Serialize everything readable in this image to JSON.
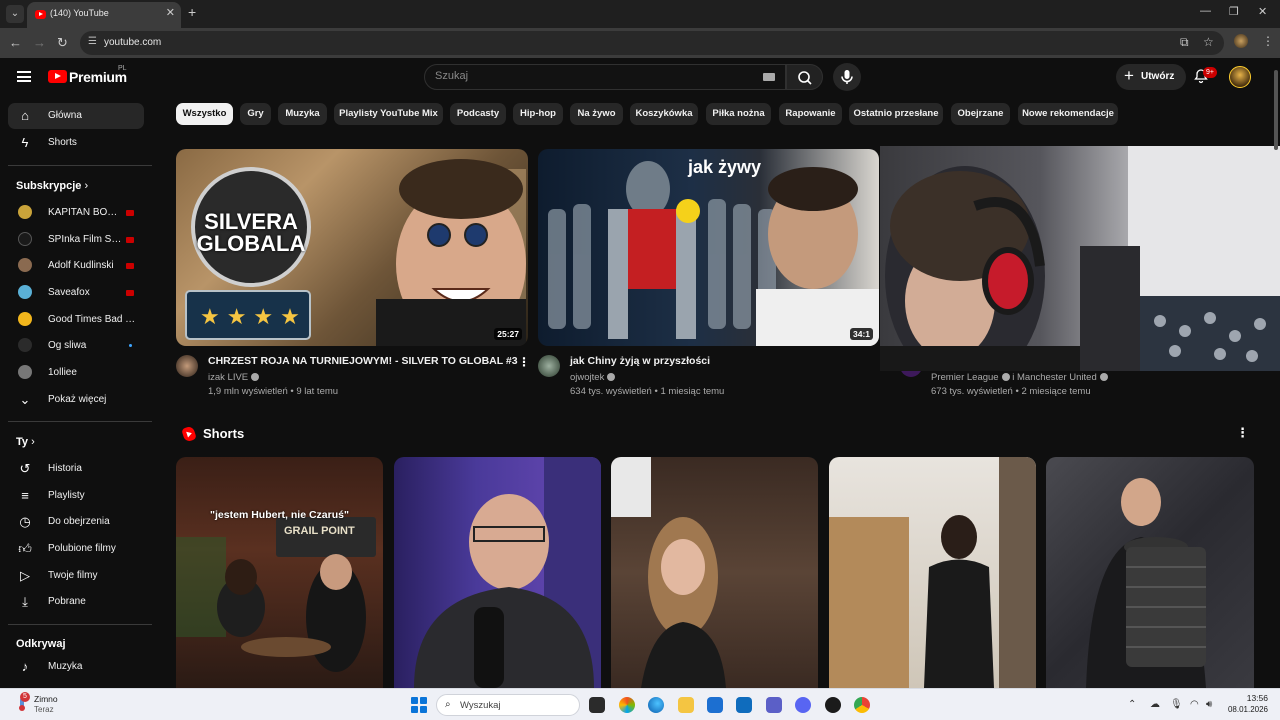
{
  "browser": {
    "tab_title": "(140) YouTube",
    "url": "youtube.com"
  },
  "masthead": {
    "logo_text": "Premium",
    "logo_region": "PL",
    "search_placeholder": "Szukaj",
    "create_label": "Utwórz",
    "notifications_badge": "9+"
  },
  "sidebar": {
    "main": [
      {
        "label": "Główna",
        "icon": "home-icon",
        "active": true
      },
      {
        "label": "Shorts",
        "icon": "shorts-icon",
        "active": false
      }
    ],
    "subscriptions_title": "Subskrypcje",
    "subscriptions": [
      {
        "label": "KAPITAN BOMB...",
        "indicator": "live",
        "color": "#c9a33a"
      },
      {
        "label": "SPInka Film Stud...",
        "indicator": "live",
        "color": "#1a1a1a"
      },
      {
        "label": "Adolf Kudlinski",
        "indicator": "live",
        "color": "#8a6a50"
      },
      {
        "label": "Saveafox",
        "indicator": "live",
        "color": "#5ab0d6"
      },
      {
        "label": "Good Times Bad Ti...",
        "indicator": "none",
        "color": "#f2b61c"
      },
      {
        "label": "Og sliwa",
        "indicator": "dot",
        "color": "#2b2b2b"
      },
      {
        "label": "1olliee",
        "indicator": "none",
        "color": "#777777"
      }
    ],
    "show_more": "Pokaż więcej",
    "you_title": "Ty",
    "you_items": [
      {
        "label": "Historia",
        "icon": "history-icon"
      },
      {
        "label": "Playlisty",
        "icon": "playlists-icon"
      },
      {
        "label": "Do obejrzenia",
        "icon": "watch-later-icon"
      },
      {
        "label": "Polubione filmy",
        "icon": "like-icon"
      },
      {
        "label": "Twoje filmy",
        "icon": "your-videos-icon"
      },
      {
        "label": "Pobrane",
        "icon": "download-icon"
      }
    ],
    "explore_title": "Odkrywaj",
    "explore_items": [
      {
        "label": "Muzyka",
        "icon": "music-icon"
      }
    ]
  },
  "chips": [
    "Wszystko",
    "Gry",
    "Muzyka",
    "Playlisty YouTube Mix",
    "Podcasty",
    "Hip-hop",
    "Na żywo",
    "Koszykówka",
    "Piłka nożna",
    "Rapowanie",
    "Ostatnio przesłane",
    "Obejrzane",
    "Nowe rekomendacje"
  ],
  "videos": [
    {
      "title": "CHRZEST ROJA NA TURNIEJOWYM! - SILVER TO GLOBAL #3",
      "channel": "izak LIVE",
      "meta": "1,9 mln wyświetleń • 9 lat temu",
      "duration": "25:27",
      "thumb_text": "SILVERA GLOBALA"
    },
    {
      "title": "jak Chiny żyją w przyszłości",
      "channel": "ojwojtek",
      "meta": "634 tys. wyświetleń • 1 miesiąc temu",
      "duration": "34:1",
      "thumb_text": "jak żywy"
    },
    {
      "title": "",
      "channel": "Premier League",
      "channel_extra": "i Manchester United",
      "meta": "673 tys. wyświetleń • 2 miesiące temu",
      "duration": ""
    }
  ],
  "shorts": {
    "title": "Shorts",
    "items": [
      {
        "caption": "\"jestem Hubert, nie Czaruś\"",
        "sign": "GRAIL POINT"
      },
      {
        "caption": ""
      },
      {
        "caption": ""
      },
      {
        "caption": ""
      },
      {
        "caption": ""
      }
    ]
  },
  "taskbar": {
    "weather_title": "Zimno",
    "weather_sub": "Teraz",
    "weather_badge": "5",
    "search_label": "Wyszukaj",
    "time": "13:56",
    "date": "08.01.2026"
  }
}
